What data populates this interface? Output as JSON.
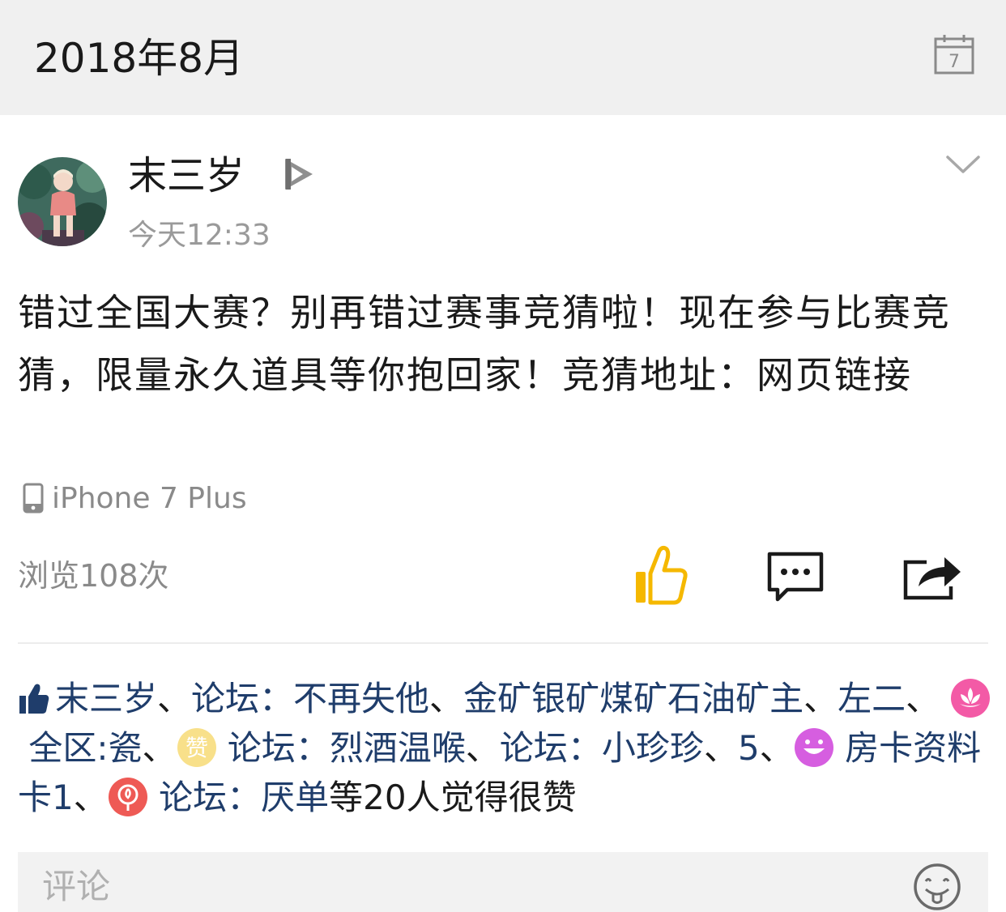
{
  "header": {
    "month_title": "2018年8月",
    "calendar_icon_day": "7"
  },
  "post": {
    "author": "末三岁",
    "time": "今天12:33",
    "body": "错过全国大赛？别再错过赛事竞猜啦！现在参与比赛竞猜，限量永久道具等你抱回家！竞猜地址：网页链接",
    "device": "iPhone 7 Plus",
    "views": "浏览108次",
    "like_color": "#F5B800",
    "likes": {
      "u1": "末三岁",
      "sep1": "、",
      "u2": "论坛：不再失他",
      "sep2": "、",
      "u3": "金矿银矿煤矿石油矿主",
      "sep3": "、",
      "u4": "左二",
      "sep4": "、",
      "u5": "全区:瓷",
      "sep5": "、",
      "u6": "论坛：烈酒温喉",
      "sep6": "、",
      "u7": "论坛：小珍珍",
      "sep7": "、",
      "u8": "5",
      "sep8": "、",
      "u9": "房卡资料卡1",
      "sep9": "、",
      "u10": "论坛：厌单",
      "tail": "等20人觉得很赞",
      "badge_zan_text": "赞"
    }
  },
  "comment": {
    "placeholder": "评论"
  }
}
